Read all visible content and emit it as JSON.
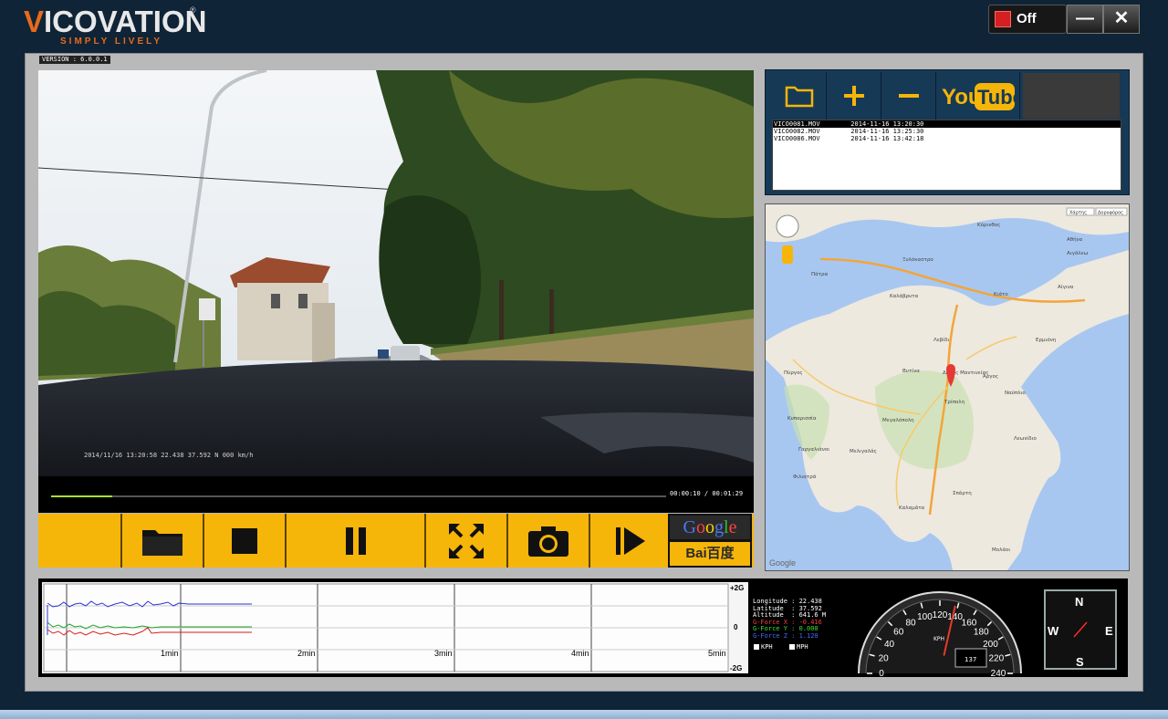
{
  "header": {
    "logo_main": "VICOVATION",
    "logo_tagline": "SIMPLY LIVELY",
    "logo_reg": "®",
    "record_toggle": "Off",
    "minimize": "—",
    "close": "✕"
  },
  "version": "VERSION : 6.0.0.1",
  "video": {
    "overlay_text": "2014/11/16 13:20:58 22.438 37.592 N 000 km/h",
    "current_time": "00:00:10",
    "total_time": "00:01:29",
    "progress": 0.1
  },
  "controls": {
    "icons": [
      "blank",
      "folder-icon",
      "stop-icon",
      "pause-icon",
      "fullscreen-icon",
      "camera-icon",
      "next-frame-icon"
    ],
    "google": "Google",
    "baidu": "Bai百度"
  },
  "playlist": {
    "toolbar": [
      "folder-icon",
      "add-icon",
      "remove-icon",
      "youtube-icon"
    ],
    "youtube_you": "You",
    "youtube_tube": "Tube",
    "files": [
      {
        "name": "VICO0081.MOV",
        "date": "2014-11-16",
        "time": "13:20:30",
        "selected": true
      },
      {
        "name": "VICO0082.MOV",
        "date": "2014-11-16",
        "time": "13:25:30",
        "selected": false
      },
      {
        "name": "VICO0086.MOV",
        "date": "2014-11-16",
        "time": "13:42:18",
        "selected": false
      }
    ]
  },
  "map": {
    "btn_map": "Χάρτης",
    "btn_sat": "Δορυφόρος",
    "labels": [
      "Πάτρα",
      "Κόρινθος",
      "Αθήνα",
      "Τρίπολη",
      "Καλαμάτα",
      "Πύργος",
      "Σπάρτη",
      "Άργος",
      "Μεγαλόπολη",
      "Ναύπλιο",
      "Φιλιατρά",
      "Γαργαλιάνοι",
      "Αιγάλεω",
      "Κιάτο",
      "Λεωνίδιο",
      "Μολάοι",
      "Κυπαρισσία",
      "Μελιγαλάς",
      "Ξυλόκαστρο",
      "Δήμος Μαντινείας",
      "Καλάβρυτα",
      "Ερμιόνη",
      "Βυτίνα",
      "Λεβίδι",
      "Αίγινα"
    ],
    "attribution": "Google",
    "marker_label": "Δήμος Μαντινείας"
  },
  "gforce_chart": {
    "y_labels": [
      "+2G",
      "0",
      "-2G"
    ],
    "x_labels": [
      "1min",
      "2min",
      "3min",
      "4min",
      "5min"
    ],
    "series_colors": {
      "x": "#d81e1e",
      "y": "#1fa52a",
      "z": "#2a34d6"
    }
  },
  "telemetry": {
    "lines": [
      {
        "text": "Longitude : 22.438",
        "color": "#ffffff"
      },
      {
        "text": "Latitude  : 37.592",
        "color": "#ffffff"
      },
      {
        "text": "Altitude  : 641.6 M",
        "color": "#ffffff"
      },
      {
        "text": "G-Force X : -0.416",
        "color": "#ff3b3b"
      },
      {
        "text": "G-Force Y : 0.000",
        "color": "#3be03b"
      },
      {
        "text": "G-Force Z : 1.120",
        "color": "#4a6bff"
      }
    ],
    "unit_kph": "KPH",
    "unit_mph": "MPH"
  },
  "speedometer": {
    "ticks": [
      "0",
      "20",
      "40",
      "60",
      "80",
      "100",
      "120",
      "140",
      "160",
      "180",
      "200",
      "220",
      "240"
    ],
    "unit": "KPH",
    "value": "137",
    "max": 240
  },
  "compass": {
    "n": "N",
    "s": "S",
    "e": "E",
    "w": "W"
  }
}
